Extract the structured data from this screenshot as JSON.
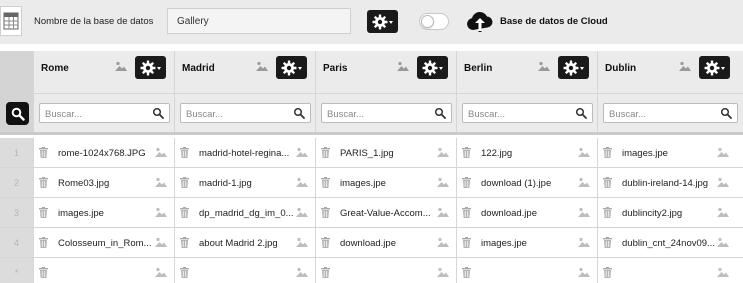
{
  "toolbar": {
    "db_label": "Nombre de la base de datos",
    "db_name": "Gallery",
    "cloud_label": "Base de datos de Cloud",
    "cloud_toggle_on": false
  },
  "columns": [
    {
      "name": "Rome"
    },
    {
      "name": "Madrid"
    },
    {
      "name": "Paris"
    },
    {
      "name": "Berlin"
    },
    {
      "name": "Dublin"
    }
  ],
  "search_placeholder": "Buscar...",
  "rows": [
    {
      "index": "1",
      "cells": [
        "rome-1024x768.JPG",
        "madrid-hotel-regina...",
        "PARIS_1.jpg",
        "122.jpg",
        "images.jpe"
      ]
    },
    {
      "index": "2",
      "cells": [
        "Rome03.jpg",
        "madrid-1.jpg",
        "images.jpe",
        "download (1).jpe",
        "dublin-ireland-14.jpg"
      ]
    },
    {
      "index": "3",
      "cells": [
        "images.jpe",
        "dp_madrid_dg_im_0...",
        "Great-Value-Accom...",
        "download.jpe",
        "dublincity2.jpg"
      ]
    },
    {
      "index": "4",
      "cells": [
        "Colosseum_in_Rom...",
        "about Madrid 2.jpg",
        "download.jpe",
        "images.jpe",
        "dublin_cnt_24nov09..."
      ]
    },
    {
      "index": "*",
      "cells": [
        "",
        "",
        "",
        "",
        ""
      ]
    }
  ],
  "colors": {
    "toolbar_bg": "#ebebeb",
    "button_dark": "#1a1a1a",
    "index_bg": "#dcdcdc"
  }
}
